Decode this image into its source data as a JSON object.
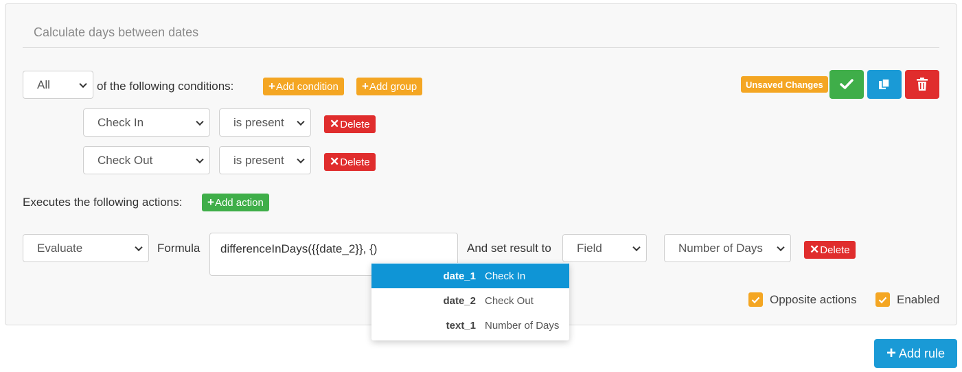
{
  "rule": {
    "title": "Calculate days between dates",
    "match_select": "All",
    "conditions_text": "of the following conditions:",
    "add_condition": "Add condition",
    "add_group": "Add group",
    "unsaved_badge": "Unsaved Changes",
    "conditions": [
      {
        "field": "Check In",
        "operator": "is present",
        "delete": "Delete"
      },
      {
        "field": "Check Out",
        "operator": "is present",
        "delete": "Delete"
      }
    ],
    "actions_text": "Executes the following actions:",
    "add_action": "Add action",
    "action": {
      "type": "Evaluate",
      "formula_label": "Formula",
      "formula_value": "differenceInDays({{date_2}}, {)",
      "set_result_text": "And set result to",
      "target_type": "Field",
      "target_field": "Number of Days",
      "delete": "Delete"
    },
    "autocomplete": [
      {
        "key": "date_1",
        "label": "Check In"
      },
      {
        "key": "date_2",
        "label": "Check Out"
      },
      {
        "key": "text_1",
        "label": "Number of Days"
      }
    ],
    "opposite_actions": "Opposite actions",
    "enabled": "Enabled"
  },
  "add_rule": "Add rule",
  "colors": {
    "orange": "#f4a623",
    "red": "#e02d2d",
    "green": "#3fae49",
    "blue": "#1a9ad6"
  }
}
